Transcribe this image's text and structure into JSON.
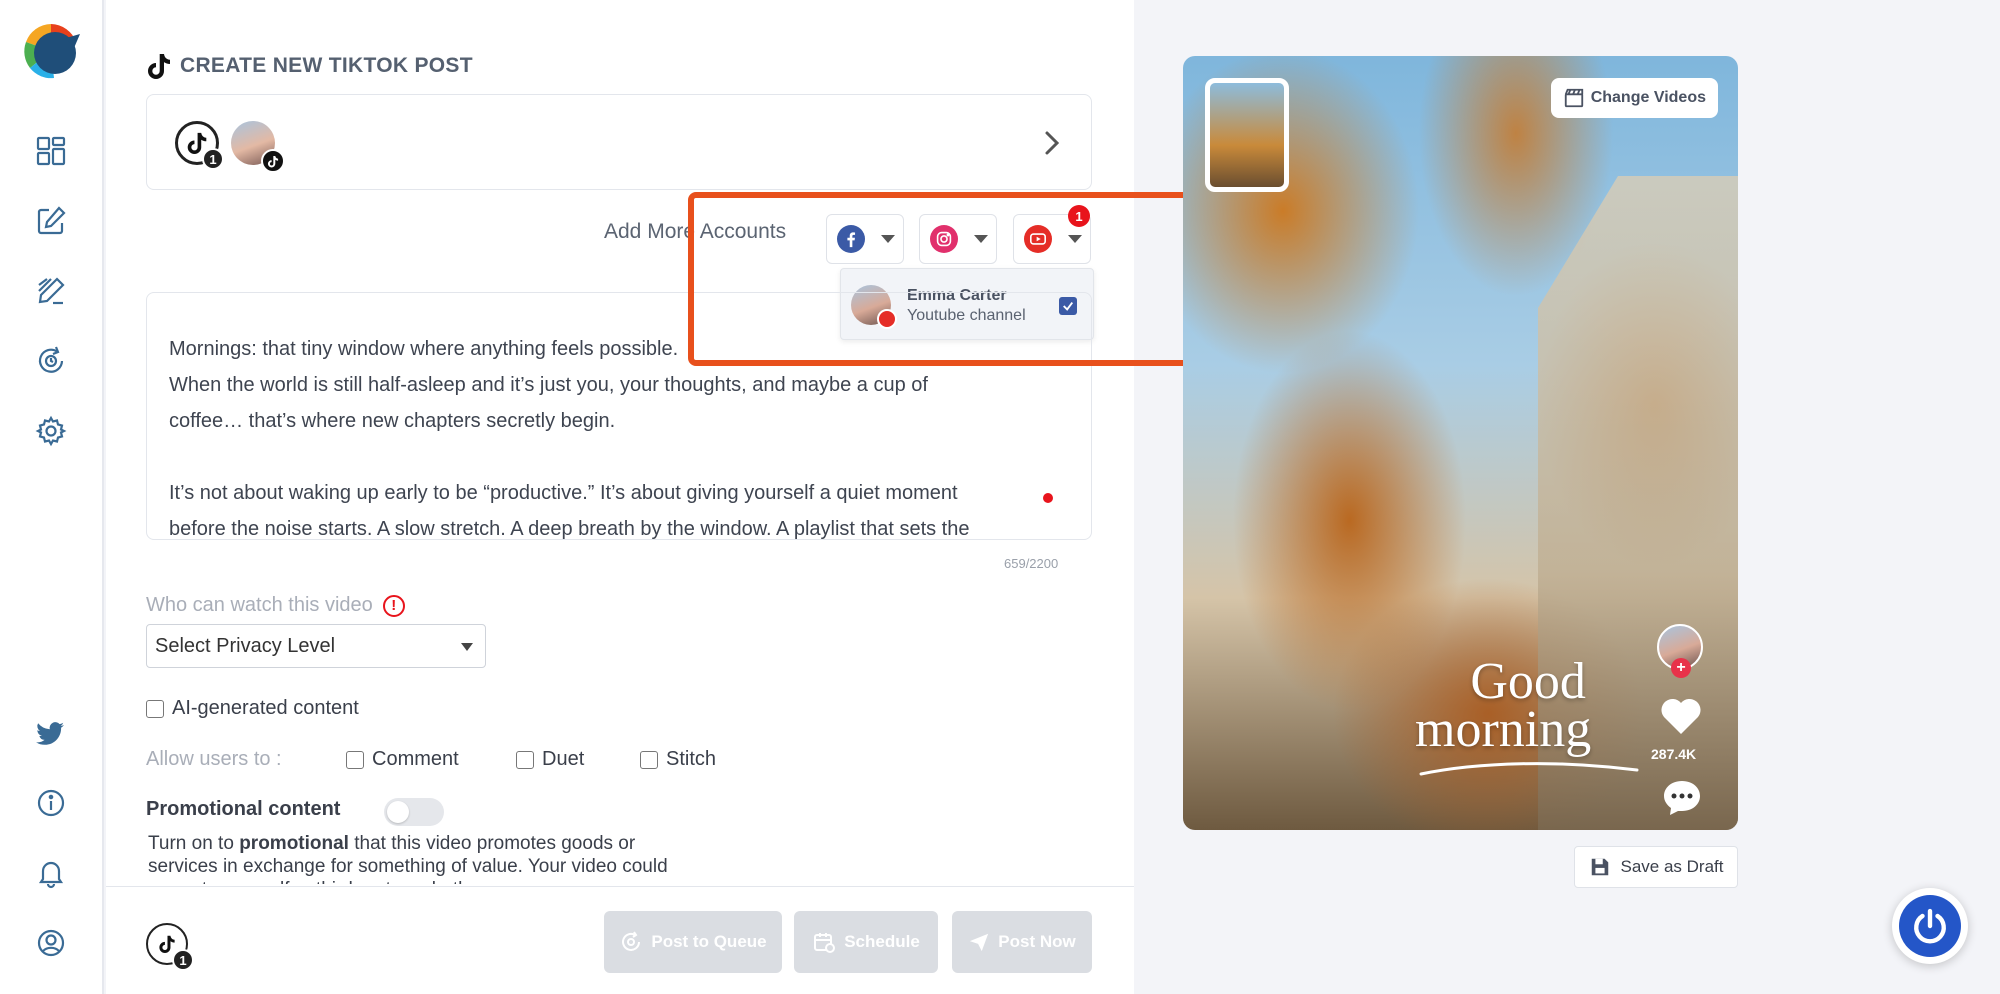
{
  "page": {
    "title": "CREATE NEW TIKTOK POST"
  },
  "colors": {
    "accent": "#e8501c",
    "youtube": "#e52d27",
    "facebook": "#3b5aa6",
    "instagram": "#e1306c",
    "primary_blue": "#2456c8"
  },
  "sidebar": {
    "top_icons": [
      "dashboard-icon",
      "compose-icon",
      "drafts-icon",
      "recycle-icon",
      "settings-icon"
    ],
    "bottom_icons": [
      "twitter-icon",
      "info-icon",
      "bell-icon",
      "user-icon"
    ]
  },
  "accounts": {
    "tiktok_count": "1"
  },
  "add_accounts": {
    "label": "Add More Accounts",
    "youtube_badge": "1",
    "youtube_menu": {
      "name": "Emma Carter",
      "subtitle": "Youtube channel",
      "checked": true
    }
  },
  "caption": {
    "lines": [
      "Mornings: that tiny window where anything feels possible.",
      "When the world is still half-asleep and it’s just you, your thoughts, and maybe a cup of",
      "coffee… that’s where new chapters secretly begin.",
      "",
      "It’s not about waking up early to be “productive.” It’s about giving yourself a quiet moment",
      "before the noise starts. A slow stretch. A deep breath by the window. A playlist that sets the"
    ],
    "counter": "659/2200"
  },
  "privacy": {
    "label": "Who can watch this video",
    "warn": "!",
    "placeholder": "Select Privacy Level"
  },
  "ai_content": {
    "label": "AI-generated content",
    "checked": false
  },
  "allow": {
    "label": "Allow users to :",
    "comment": "Comment",
    "duet": "Duet",
    "stitch": "Stitch"
  },
  "promotional": {
    "label": "Promotional content",
    "enabled": false,
    "desc_pre": "Turn on to ",
    "desc_bold": "promotional",
    "desc_post": " that this video promotes goods or services in exchange for something of value. Your video could promote yourself, a third party, or both."
  },
  "footer": {
    "tiktok_count": "1",
    "post_to_queue": "Post to Queue",
    "schedule": "Schedule",
    "post_now": "Post Now"
  },
  "preview": {
    "change_videos": "Change Videos",
    "overlay_line1": "Good",
    "overlay_line2": "morning",
    "likes": "287.4K",
    "save_draft": "Save as Draft"
  }
}
